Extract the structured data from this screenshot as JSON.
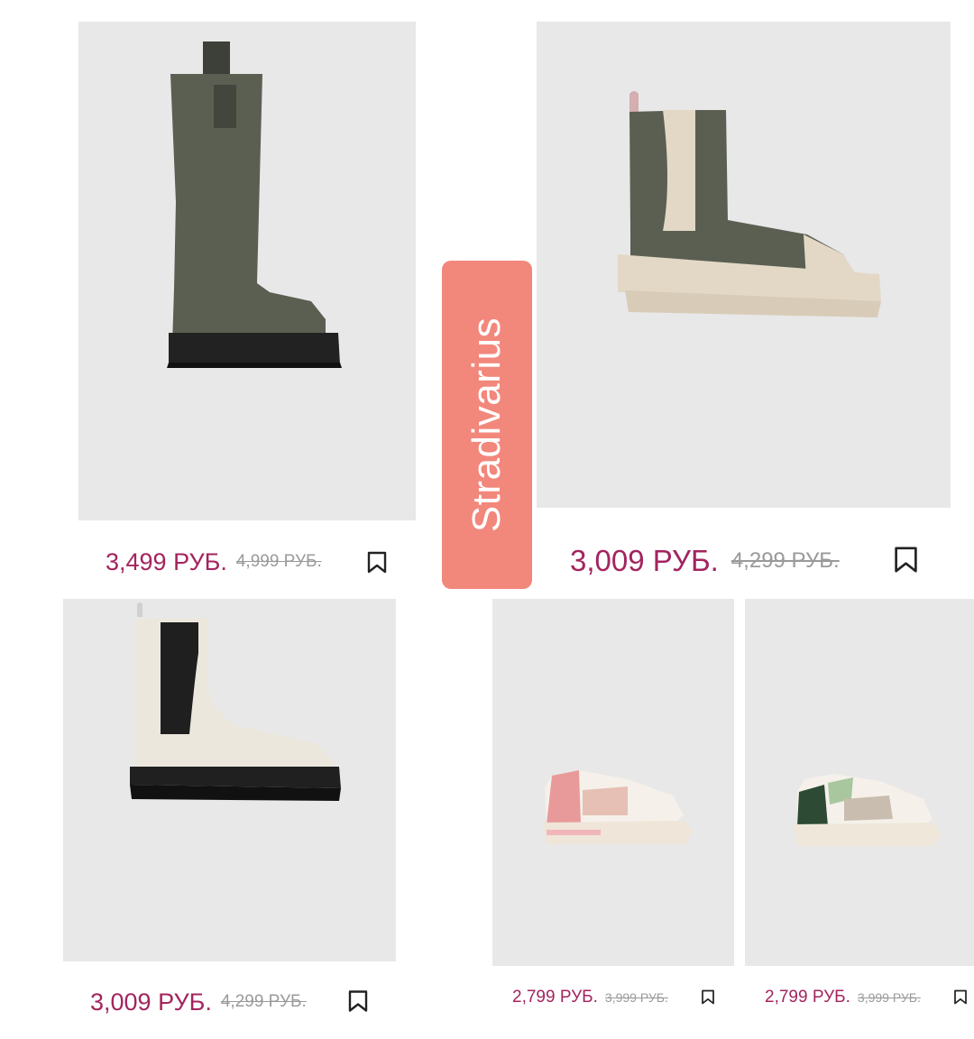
{
  "brand_label": "Stradivarius",
  "colors": {
    "price": "#a3245e",
    "old_price": "#9a9a9a",
    "brand_bg": "#f2877c",
    "photo_bg": "#e8e8e8"
  },
  "products": [
    {
      "image": "khaki-tall-boot",
      "price": "3,499 РУБ.",
      "old_price": "4,999 РУБ.",
      "icon": "bookmark-icon"
    },
    {
      "image": "khaki-chelsea-boot-beige-sole",
      "price": "3,009 РУБ.",
      "old_price": "4,299 РУБ.",
      "icon": "bookmark-icon"
    },
    {
      "image": "white-black-ankle-boot",
      "price": "3,009 РУБ.",
      "old_price": "4,299 РУБ.",
      "icon": "bookmark-icon"
    },
    {
      "image": "pink-sneaker",
      "price": "2,799 РУБ.",
      "old_price": "3,999 РУБ.",
      "icon": "bookmark-icon"
    },
    {
      "image": "green-sneaker",
      "price": "2,799 РУБ.",
      "old_price": "3,999 РУБ.",
      "icon": "bookmark-icon"
    }
  ]
}
